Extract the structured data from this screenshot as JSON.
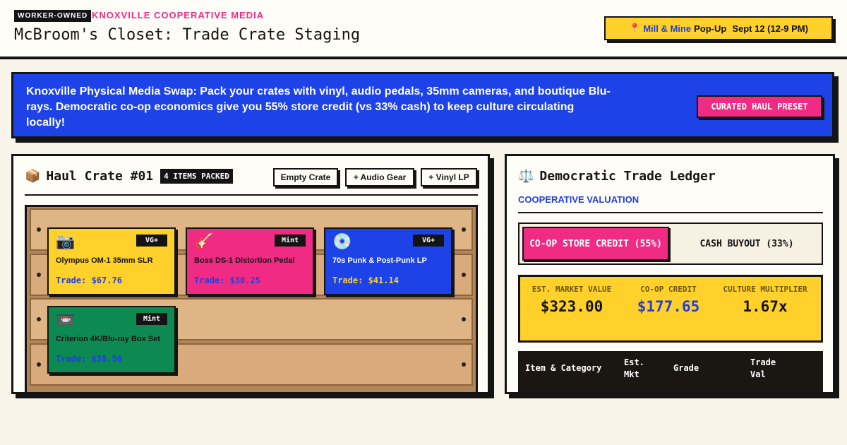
{
  "header": {
    "tag": "WORKER-OWNED",
    "org": "KNOXVILLE COOPERATIVE MEDIA",
    "title": "McBroom's Closet: Trade Crate Staging",
    "popup": {
      "pin_icon": "pin-icon",
      "venue": "Mill & Mine",
      "label": "Pop-Up",
      "date": "Sept 12 (12-9 PM)"
    }
  },
  "banner": {
    "text": "Knoxville Physical Media Swap: Pack your crates with vinyl, audio pedals, 35mm cameras, and boutique Blu-rays. Democratic co-op economics give you 55% store credit (vs 33% cash) to keep culture circulating locally!",
    "preset_label": "CURATED HAUL PRESET"
  },
  "crate_panel": {
    "title_icon": "package-icon",
    "title": "Haul Crate #01",
    "packed_badge": "4 ITEMS PACKED",
    "buttons": {
      "empty": "Empty Crate",
      "audio": "+ Audio Gear",
      "vinyl": "+ Vinyl LP"
    },
    "items": [
      {
        "icon": "camera-icon",
        "glyph": "📷",
        "grade": "VG+",
        "name": "Olympus OM-1 35mm SLR",
        "trade": "Trade: $67.76",
        "bg": "#ffd12a",
        "text": "#141414",
        "trade_color": "#1f3fe0"
      },
      {
        "icon": "guitar-icon",
        "glyph": "🎸",
        "grade": "Mint",
        "name": "Boss DS-1 Distortion Pedal",
        "trade": "Trade: $30.25",
        "bg": "#ef2b84",
        "text": "#141414",
        "trade_color": "#1f3fe0"
      },
      {
        "icon": "disc-icon",
        "glyph": "💿",
        "grade": "VG+",
        "name": "70s Punk & Post-Punk LP",
        "trade": "Trade: $41.14",
        "bg": "#1d43e8",
        "text": "#ffffff",
        "trade_color": "#ffd12a"
      },
      {
        "icon": "cassette-icon",
        "glyph": "📼",
        "grade": "Mint",
        "name": "Criterion 4K/Blu-ray Box Set",
        "trade": "Trade: $38.50",
        "bg": "#0d8a52",
        "text": "#141414",
        "trade_color": "#1f3fe0"
      }
    ]
  },
  "ledger_panel": {
    "title_icon": "scales-icon",
    "title": "Democratic Trade Ledger",
    "subtitle": "COOPERATIVE VALUATION",
    "toggle": {
      "active": "CO-OP STORE CREDIT (55%)",
      "inactive": "CASH BUYOUT (33%)"
    },
    "stats": {
      "market_label": "EST. MARKET VALUE",
      "market_value": "$323.00",
      "credit_label": "CO-OP CREDIT",
      "credit_value": "$177.65",
      "multiplier_label": "CULTURE MULTIPLIER",
      "multiplier_value": "1.67x"
    },
    "table_headers": {
      "item": "Item & Category",
      "mkt": "Est. Mkt",
      "grade": "Grade",
      "trade": "Trade Val"
    }
  }
}
